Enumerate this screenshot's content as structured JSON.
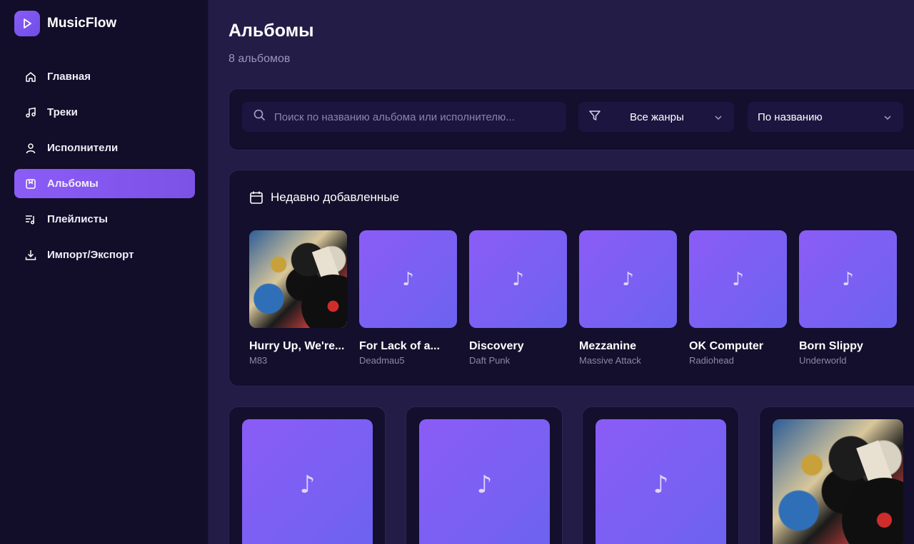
{
  "app": {
    "name": "MusicFlow"
  },
  "sidebar": {
    "items": [
      {
        "label": "Главная",
        "icon": "home-icon",
        "active": false
      },
      {
        "label": "Треки",
        "icon": "music-note-icon",
        "active": false
      },
      {
        "label": "Исполнители",
        "icon": "user-icon",
        "active": false
      },
      {
        "label": "Альбомы",
        "icon": "album-icon",
        "active": true
      },
      {
        "label": "Плейлисты",
        "icon": "playlist-icon",
        "active": false
      },
      {
        "label": "Импорт/Экспорт",
        "icon": "download-icon",
        "active": false
      }
    ]
  },
  "header": {
    "title": "Альбомы",
    "subtitle": "8 альбомов"
  },
  "filters": {
    "search_placeholder": "Поиск по названию альбома или исполнителю...",
    "genre_value": "Все жанры",
    "sort_value": "По названию"
  },
  "recent": {
    "heading": "Недавно добавленные",
    "albums": [
      {
        "title": "Hurry Up, We're...",
        "artist": "M83",
        "cover": "image"
      },
      {
        "title": "For Lack of a...",
        "artist": "Deadmau5",
        "cover": "placeholder"
      },
      {
        "title": "Discovery",
        "artist": "Daft Punk",
        "cover": "placeholder"
      },
      {
        "title": "Mezzanine",
        "artist": "Massive Attack",
        "cover": "placeholder"
      },
      {
        "title": "OK Computer",
        "artist": "Radiohead",
        "cover": "placeholder"
      },
      {
        "title": "Born Slippy",
        "artist": "Underworld",
        "cover": "placeholder"
      }
    ]
  },
  "grid": {
    "note_glyph": "♪"
  },
  "colors": {
    "accent": "#8b5cf6",
    "sidebar_bg": "#120d28",
    "main_bg": "#221c47",
    "card_bg": "#130f2d"
  }
}
